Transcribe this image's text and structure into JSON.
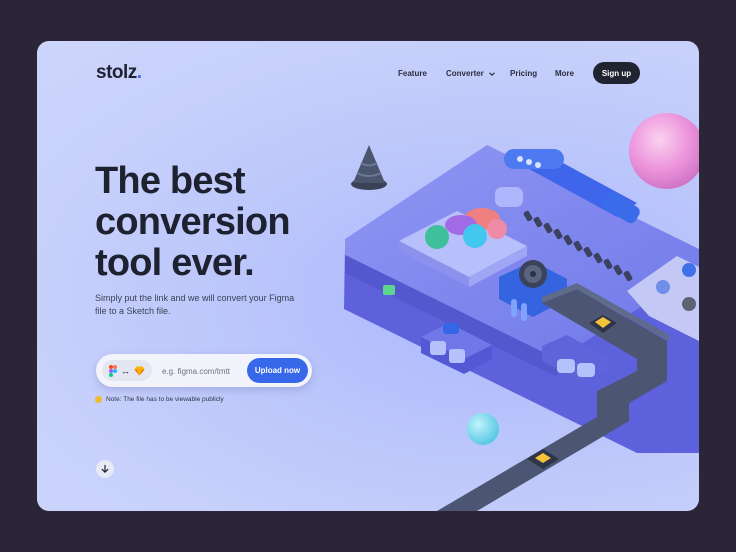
{
  "brand": {
    "name": "stolz",
    "dot": "."
  },
  "nav": {
    "items": [
      {
        "label": "Feature"
      },
      {
        "label": "Converter",
        "has_dropdown": true
      },
      {
        "label": "Pricing"
      },
      {
        "label": "More"
      }
    ],
    "signup_label": "Sign up"
  },
  "hero": {
    "headline_lines": [
      "The best",
      "conversion",
      "tool ever."
    ],
    "subtitle": "Simply put the link and we will convert your Figma file to a Sketch file."
  },
  "uploader": {
    "swap_symbol": "↔",
    "source_icon": "figma-icon",
    "target_icon": "sketch-icon",
    "input_placeholder": "e.g. figma.com/tmtt",
    "input_value": "",
    "button_label": "Upload now"
  },
  "note": {
    "text": "Note: The file has to be viewable publicly",
    "icon": "sunglasses-emoji-icon"
  },
  "scroll": {
    "icon": "arrow-down-icon"
  },
  "colors": {
    "background_outer": "#2b2538",
    "card_bg": "#c7d0fb",
    "accent_blue": "#3868ea",
    "dark": "#202330",
    "machine_purple": "#6a6ee6"
  }
}
